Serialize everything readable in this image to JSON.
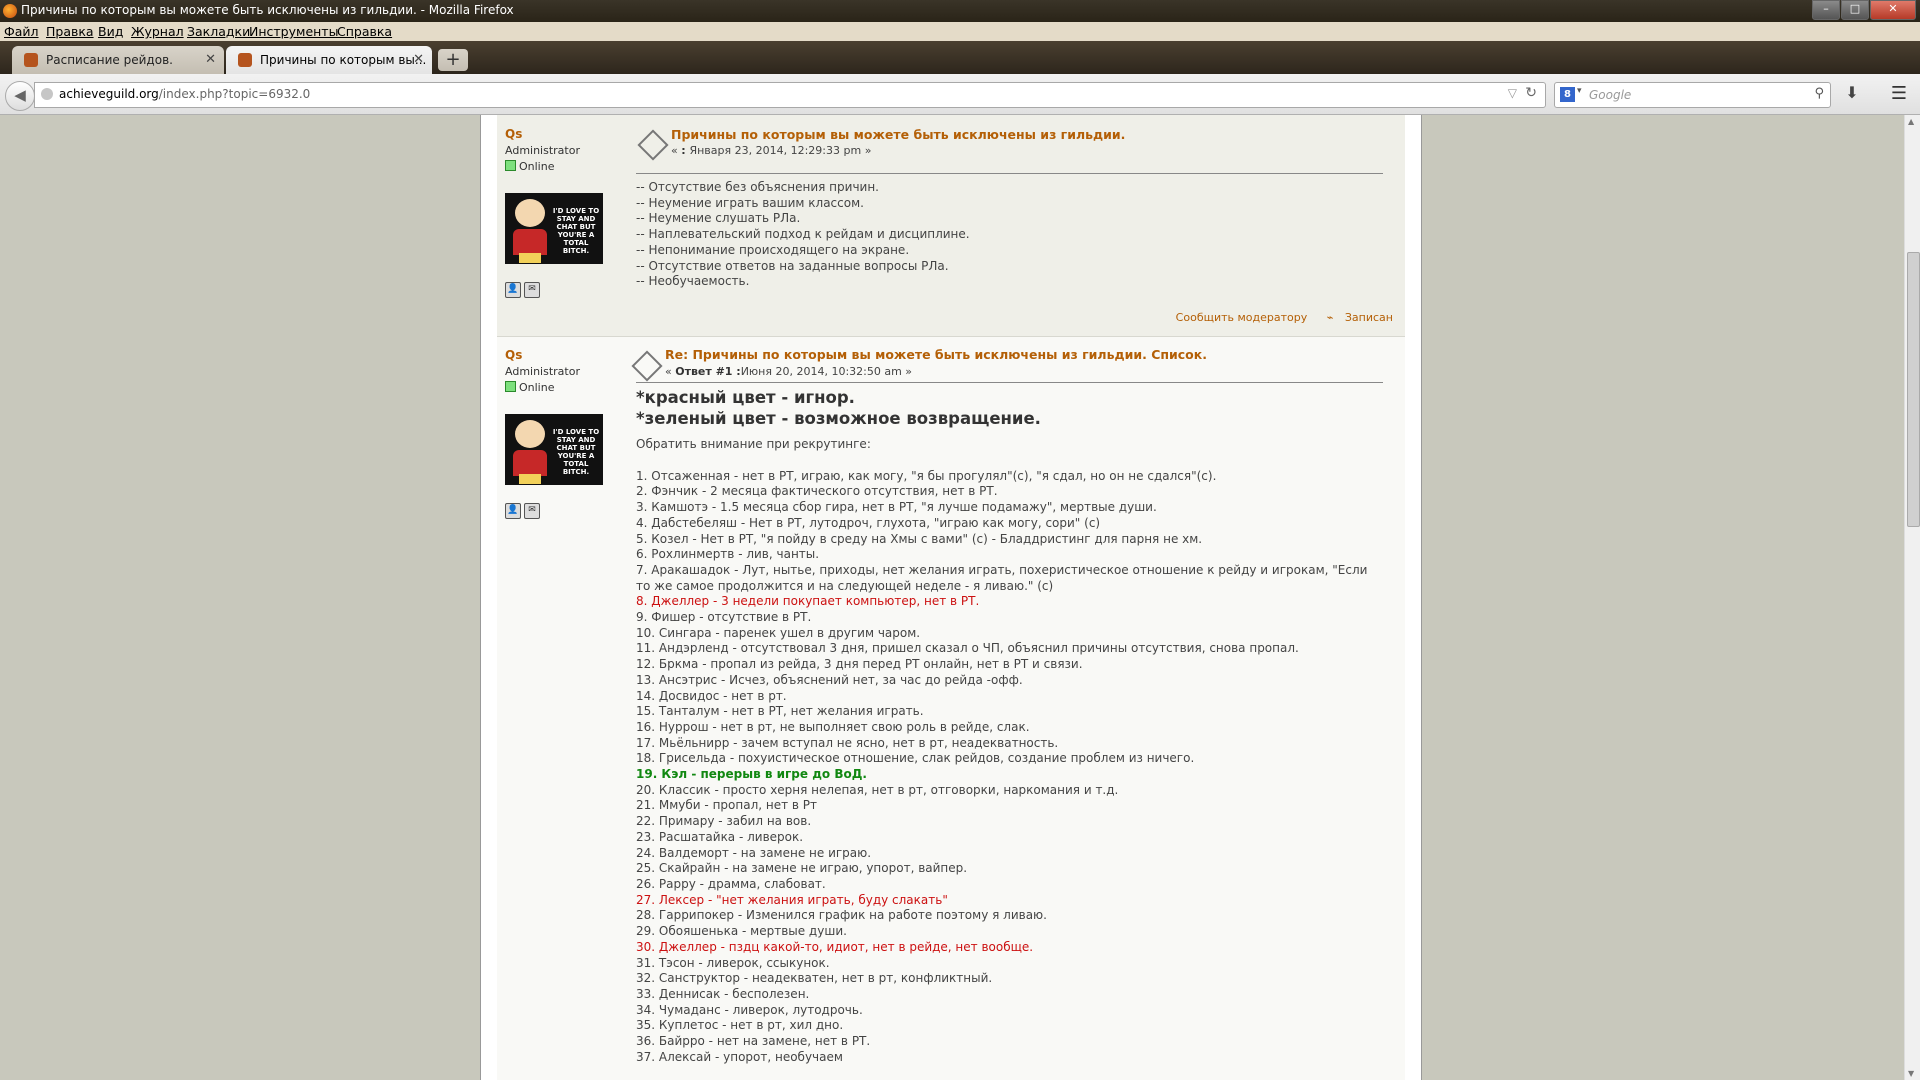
{
  "window": {
    "title": "Причины по которым вы можете быть исключены из гильдии. - Mozilla Firefox",
    "controls": [
      "–",
      "□",
      "✕"
    ]
  },
  "menubar": [
    "Файл",
    "Правка",
    "Вид",
    "Журнал",
    "Закладки",
    "Инструменты",
    "Справка"
  ],
  "tabs": [
    {
      "label": "Расписание рейдов.",
      "active": false
    },
    {
      "label": "Причины по которым вы...",
      "active": true
    }
  ],
  "newtab_label": "+",
  "navbar": {
    "url_domain": "achieveguild.org",
    "url_path": "/index.php?topic=6932.0",
    "search_placeholder": "Google",
    "search_engine_letter": "8"
  },
  "post1": {
    "author": "Qs",
    "role": "Administrator",
    "status": "Online",
    "avatar_text": "I'D LOVE TO STAY AND CHAT BUT YOU'RE A TOTAL BITCH.",
    "title": "Причины по которым вы можете быть исключены из гильдии.",
    "meta_prefix": "« ",
    "meta_on": ": ",
    "meta_date": "Января 23, 2014, 12:29:33 pm »",
    "lines": [
      "-- Отсутствие без объяснения причин.",
      "-- Неумение играть вашим классом.",
      "-- Неумение слушать РЛа.",
      "-- Наплевательский подход к рейдам и дисциплине.",
      "-- Непонимание происходящего на экране.",
      "-- Отсутствие ответов на заданные вопросы РЛа.",
      "-- Необучаемость."
    ],
    "report_link": "Сообщить модератору",
    "logged_label": "Записан"
  },
  "post2": {
    "author": "Qs",
    "role": "Administrator",
    "status": "Online",
    "avatar_text": "I'D LOVE TO STAY AND CHAT BUT YOU'RE A TOTAL BITCH.",
    "title": "Re: Причины по которым вы можете быть исключены из гильдии. Список.",
    "meta_prefix": "« ",
    "meta_reply": "Ответ #1 :",
    "meta_date": "Июня 20, 2014, 10:32:50 am »",
    "heading1": "*красный цвет - игнор.",
    "heading2": "*зеленый цвет - возможное возвращение.",
    "intro": "Обратить внимание при рекрутинге:",
    "list": [
      {
        "text": "1. Отсаженная - нет в РТ, играю, как могу, \"я бы прогулял\"(с), \"я сдал, но он не сдался\"(с).",
        "style": "normal"
      },
      {
        "text": "2. Фэнчик - 2 месяца фактического отсутствия, нет в РТ.",
        "style": "normal"
      },
      {
        "text": "3. Камшотэ - 1.5 месяца сбор гира, нет в РТ, \"я лучше подамажу\", мертвые души.",
        "style": "normal"
      },
      {
        "text": "4. Дабстебеляш - Нет в РТ, лутодроч, глухота, \"играю как могу, сори\" (с)",
        "style": "normal"
      },
      {
        "text": "5. Козел - Нет в РТ, \"я пойду в среду на Хмы с вами\" (с) - Бладдристинг для парня не хм.",
        "style": "normal"
      },
      {
        "text": "6. Рохлинмертв - лив, чанты.",
        "style": "normal"
      },
      {
        "text": "7. Аракашадок - Лут, нытье, приходы, нет желания играть, похеристическое отношение к рейду и игрокам, \"Если то же самое продолжится и на следующей неделе - я ливаю.\" (с)",
        "style": "wrap"
      },
      {
        "text": "8. Джеллер - 3 недели покупает компьютер, нет в РТ.",
        "style": "red"
      },
      {
        "text": "9. Фишер - отсутствие в РТ.",
        "style": "normal"
      },
      {
        "text": "10. Сингара - паренек ушел в другим чаром.",
        "style": "normal"
      },
      {
        "text": "11. Андэрленд - отсутствовал 3 дня, пришел сказал о ЧП, объяснил причины отсутствия, снова пропал.",
        "style": "normal"
      },
      {
        "text": "12. Бркма - пропал из рейда, 3 дня перед РТ онлайн, нет в РТ и связи.",
        "style": "normal"
      },
      {
        "text": "13. Ансэтрис - Исчез, объяснений нет, за час до рейда -офф.",
        "style": "normal"
      },
      {
        "text": "14. Досвидос - нет в рт.",
        "style": "normal"
      },
      {
        "text": "15. Танталум - нет в РТ, нет желания играть.",
        "style": "normal"
      },
      {
        "text": "16. Нуррош - нет в рт, не выполняет свою роль в рейде, слак.",
        "style": "normal"
      },
      {
        "text": "17. Мьёльнирр - зачем вступал не ясно, нет в рт, неадекватность.",
        "style": "normal"
      },
      {
        "text": "18. Грисельда - похуистическое отношение, слак рейдов, создание проблем из ничего.",
        "style": "normal"
      },
      {
        "text": "19. Кэл - перерыв в игре до ВоД.",
        "style": "green"
      },
      {
        "text": "20. Классик - просто херня нелепая, нет в рт, отговорки, наркомания и т.д.",
        "style": "normal"
      },
      {
        "text": "21. Ммуби - пропал, нет в Рт",
        "style": "normal"
      },
      {
        "text": "22. Примару - забил на вов.",
        "style": "normal"
      },
      {
        "text": "23. Расшатайка - ливерок.",
        "style": "normal"
      },
      {
        "text": "24. Валдеморт - на замене не играю.",
        "style": "normal"
      },
      {
        "text": "25. Скайрайн - на замене не играю, упорот, вайпер.",
        "style": "normal"
      },
      {
        "text": "26. Рарру - драмма, слабоват.",
        "style": "normal"
      },
      {
        "text": "27. Лексер - \"нет желания играть, буду слакать\"",
        "style": "red"
      },
      {
        "text": "28. Гаррипокер -  Изменился график на работе поэтому я ливаю.",
        "style": "normal"
      },
      {
        "text": "29. Обояшенька - мертвые души.",
        "style": "normal"
      },
      {
        "text": "30. Джеллер - пздц какой-то, идиот, нет в рейде, нет вообще.",
        "style": "red"
      },
      {
        "text": "31. Тэсон - ливерок, ссыкунок.",
        "style": "normal"
      },
      {
        "text": "32. Санструктор - неадекватен, нет в рт, конфликтный.",
        "style": "normal"
      },
      {
        "text": "33. Деннисак - бесполезен.",
        "style": "normal"
      },
      {
        "text": "34. Чумаданс - ливерок, лутодрочь.",
        "style": "normal"
      },
      {
        "text": "35. Куплетос - нет в рт, хил дно.",
        "style": "normal"
      },
      {
        "text": "36. Байрро - нет на замене, нет в РТ.",
        "style": "normal"
      },
      {
        "text": "37. Алексай - упорот, необучаем",
        "style": "normal"
      }
    ]
  },
  "colors": {
    "link": "#b45f06",
    "red": "#cc1111",
    "green": "#118811"
  }
}
